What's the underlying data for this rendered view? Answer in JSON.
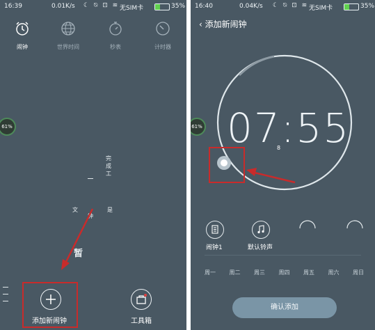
{
  "left": {
    "status": {
      "time": "16:39",
      "speed": "0.01K/s",
      "carrier": "无SIM卡",
      "battery": "35%",
      "battery_level": 0.35
    },
    "tabs": [
      {
        "label": "闹钟",
        "icon": "alarm-clock-icon",
        "active": true
      },
      {
        "label": "世界时间",
        "icon": "globe-icon",
        "active": false
      },
      {
        "label": "秒表",
        "icon": "stopwatch-icon",
        "active": false
      },
      {
        "label": "计时器",
        "icon": "timer-icon",
        "active": false
      }
    ],
    "side_badge": "61%",
    "scatter": {
      "a": "完",
      "b": "成",
      "c": "工",
      "d": "钟",
      "e": "暂",
      "f": "文",
      "g": "是"
    },
    "add_alarm_label": "添加新闹钟",
    "toolbox_label": "工具箱"
  },
  "right": {
    "status": {
      "time": "16:40",
      "speed": "0.04K/s",
      "carrier": "无SIM卡",
      "battery": "35%",
      "battery_level": 0.35
    },
    "title": "添加新闹钟",
    "side_badge": "61%",
    "dial_time": "07:55",
    "options": [
      {
        "label": "闹钟1",
        "icon": "document-icon"
      },
      {
        "label": "默认铃声",
        "icon": "music-note-icon"
      },
      {
        "label": "",
        "icon": "arc-icon"
      },
      {
        "label": "",
        "icon": "arc-icon"
      }
    ],
    "days": [
      "周一",
      "周二",
      "周三",
      "周四",
      "周五",
      "周六",
      "周日"
    ],
    "confirm_label": "确认添加"
  },
  "colors": {
    "background": "#495863",
    "annotation": "#c92b2b",
    "accent_button": "#7a95a6",
    "battery": "#61d04f"
  }
}
